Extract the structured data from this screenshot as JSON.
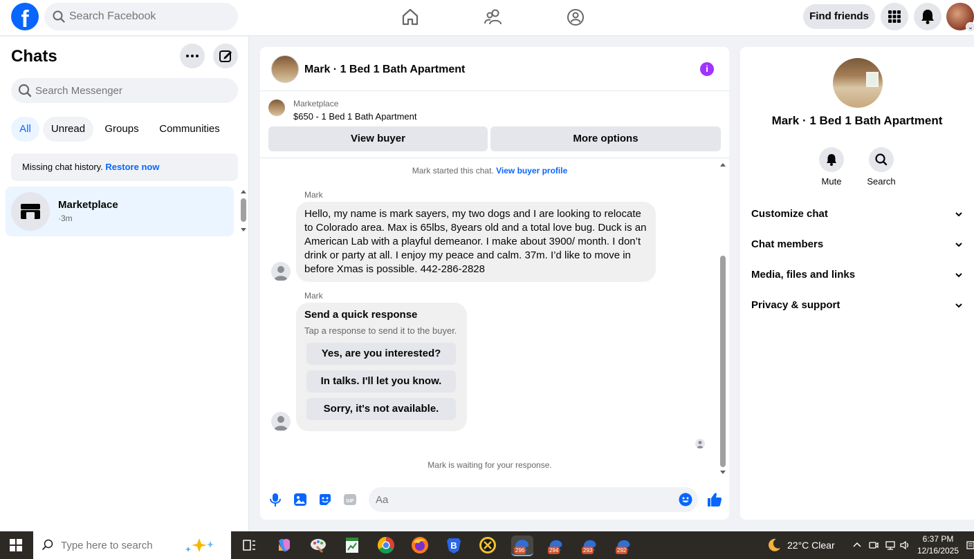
{
  "topbar": {
    "logo": "f",
    "search_placeholder": "Search Facebook",
    "find_friends": "Find friends"
  },
  "left": {
    "title": "Chats",
    "search_placeholder": "Search Messenger",
    "filters": [
      "All",
      "Unread",
      "Groups",
      "Communities"
    ],
    "missing_text": "Missing chat history. ",
    "restore_link": "Restore now",
    "chat": {
      "name": "Marketplace",
      "time": "·3m"
    }
  },
  "conversation": {
    "title": "Mark · 1 Bed 1 Bath Apartment",
    "marketplace_label": "Marketplace",
    "listing": "$650 - 1 Bed 1 Bath Apartment",
    "view_buyer": "View buyer",
    "more_options": "More options",
    "started_text": "Mark started this chat. ",
    "view_buyer_profile": "View buyer profile",
    "sender": "Mark",
    "message": "Hello, my name is mark sayers, my two dogs and I are looking to relocate to Colorado area. Max is 65lbs, 8years old and a total love bug. Duck is an American Lab with a playful demeanor. I make about 3900/ month. I don’t drink or party at all. I enjoy my peace and calm. 37m. I’d like to move in before Xmas is possible. 442-286-2828",
    "quick": {
      "title": "Send a quick response",
      "subtitle": "Tap a response to send it to the buyer.",
      "options": [
        "Yes, are you interested?",
        "In talks. I'll let you know.",
        "Sorry, it's not available."
      ]
    },
    "waiting": "Mark is waiting for your response.",
    "composer_placeholder": "Aa"
  },
  "right": {
    "name": "Mark · 1 Bed 1 Bath Apartment",
    "actions": [
      "Mute",
      "Search"
    ],
    "sections": [
      "Customize chat",
      "Chat members",
      "Media, files and links",
      "Privacy & support"
    ]
  },
  "taskbar": {
    "search_placeholder": "Type here to search",
    "badges": [
      "296",
      "294",
      "293",
      "292"
    ],
    "weather": "22°C  Clear",
    "time": "6:37 PM",
    "date": "12/16/2025"
  },
  "colors": {
    "brand": "#0866ff",
    "info": "#a033ff",
    "bubble": "#f0f0f0"
  },
  "icons": [
    "search-icon",
    "home-icon",
    "friends-icon",
    "groups-icon",
    "menu-grid-icon",
    "bell-icon",
    "more-icon",
    "compose-icon",
    "store-icon",
    "info-icon",
    "microphone-icon",
    "image-icon",
    "sticker-icon",
    "gif-icon",
    "emoji-icon",
    "like-icon",
    "chevron-down-icon"
  ]
}
